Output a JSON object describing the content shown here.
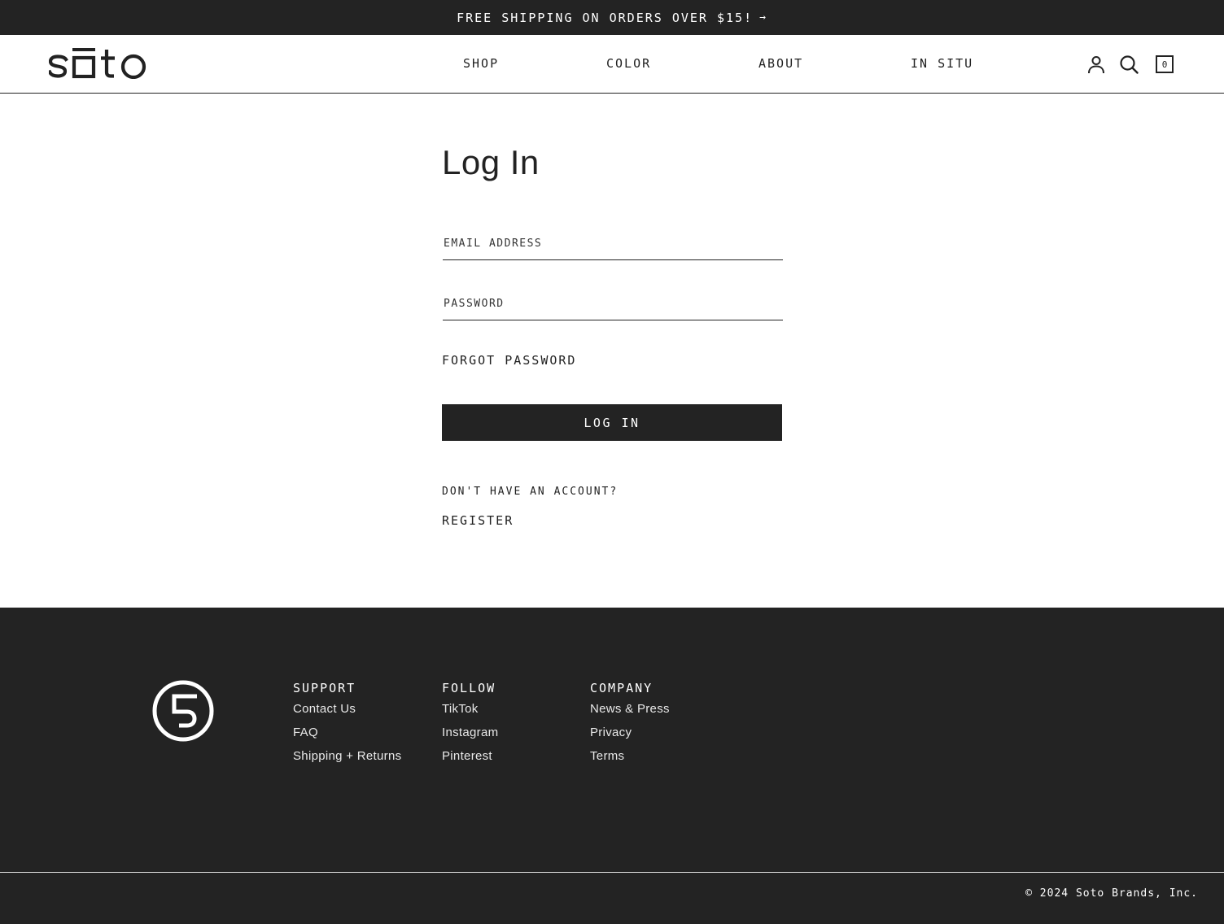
{
  "announcement": {
    "text": "FREE SHIPPING ON ORDERS OVER $15!",
    "arrow_icon": "arrow-right-icon"
  },
  "header": {
    "logo_text": "soto",
    "nav": [
      {
        "label": "SHOP"
      },
      {
        "label": "COLOR"
      },
      {
        "label": "ABOUT"
      },
      {
        "label": "IN SITU"
      }
    ],
    "icons": [
      "account-icon",
      "search-icon",
      "cart-icon"
    ],
    "cart_count": "0"
  },
  "login": {
    "title": "Log In",
    "email_placeholder": "EMAIL ADDRESS",
    "email_value": "",
    "password_placeholder": "PASSWORD",
    "password_value": "",
    "forgot_label": "FORGOT PASSWORD",
    "submit_label": "LOG IN",
    "no_account_text": "DON'T HAVE AN ACCOUNT?",
    "register_label": "REGISTER"
  },
  "footer": {
    "badge_icon": "soto-5-badge-icon",
    "columns": [
      {
        "heading": "SUPPORT",
        "links": [
          "Contact Us",
          "FAQ",
          "Shipping + Returns"
        ]
      },
      {
        "heading": "FOLLOW",
        "links": [
          "TikTok",
          "Instagram",
          "Pinterest"
        ]
      },
      {
        "heading": "COMPANY",
        "links": [
          "News & Press",
          "Privacy",
          "Terms"
        ]
      }
    ],
    "copyright": "© 2024 Soto Brands, Inc."
  },
  "colors": {
    "dark": "#232323",
    "text": "#222222",
    "background": "#ffffff"
  }
}
